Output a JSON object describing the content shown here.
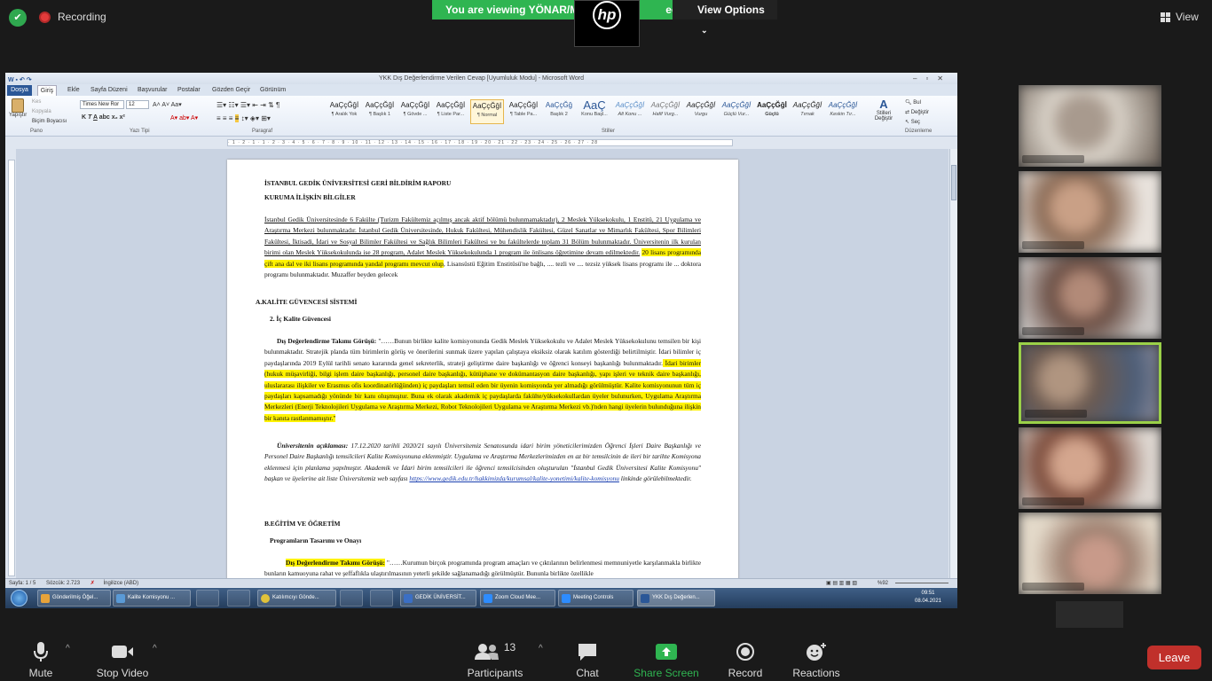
{
  "zoom": {
    "recording_label": "Recording",
    "viewing_banner": "You are viewing YÖNAR/M",
    "viewing_banner_end": "een",
    "view_options_label": "View Options",
    "view_label": "View",
    "presenter_logo": "hp",
    "toolbar": {
      "mute": "Mute",
      "stop_video": "Stop Video",
      "participants": "Participants",
      "participants_count": "13",
      "chat": "Chat",
      "share_screen": "Share Screen",
      "record": "Record",
      "reactions": "Reactions",
      "leave": "Leave"
    },
    "colors": {
      "banner_green": "#2fb551",
      "share_green": "#2fb551",
      "leave_red": "#c0302b",
      "active_speaker": "#9ad048"
    }
  },
  "word": {
    "title": "YKK Dış Değerlendirme Verilen Cevap [Uyumluluk Modu] - Microsoft Word",
    "tabs": [
      "Dosya",
      "Giriş",
      "Ekle",
      "Sayfa Düzeni",
      "Başvurular",
      "Postalar",
      "Gözden Geçir",
      "Görünüm"
    ],
    "clipboard": {
      "paste": "Yapıştır",
      "cut": "Kes",
      "copy": "Kopyala",
      "format_painter": "Biçim Boyacısı",
      "group": "Pano"
    },
    "font": {
      "name": "Times New Ror",
      "size": "12",
      "group": "Yazı Tipi"
    },
    "paragraph_group": "Paragraf",
    "styles_group": "Stiller",
    "editing_group": "Düzenleme",
    "styles": [
      {
        "preview": "AaÇçĞğİ",
        "name": "¶ Aralık Yok"
      },
      {
        "preview": "AaÇçĞğİ",
        "name": "¶ Başlık 1"
      },
      {
        "preview": "AaÇçĞğİ",
        "name": "¶ Gövde ..."
      },
      {
        "preview": "AaÇçĞğİ",
        "name": "¶ Liste Par..."
      },
      {
        "preview": "AaÇçĞğİ",
        "name": "¶ Normal"
      },
      {
        "preview": "AaÇçĞğİ",
        "name": "¶ Table Pa..."
      },
      {
        "preview": "AaÇçĞğ",
        "name": "Başlık 2"
      },
      {
        "preview": "AaÇ",
        "name": "Konu Başl..."
      },
      {
        "preview": "AaÇçĞğİ",
        "name": "Alt Konu ..."
      },
      {
        "preview": "AaÇçĞğİ",
        "name": "Hafif Vurg..."
      },
      {
        "preview": "AaÇçĞğİ",
        "name": "Vurgu"
      },
      {
        "preview": "AaÇçĞğİ",
        "name": "Güçlü Vur..."
      },
      {
        "preview": "AaÇçĞğİ",
        "name": "Güçlü"
      },
      {
        "preview": "AaÇçĞğİ",
        "name": "Tırnak"
      },
      {
        "preview": "AaÇçĞğİ",
        "name": "Keskin Tır..."
      }
    ],
    "change_styles": "Stilleri Değiştir",
    "find": "Bul",
    "replace": "Değiştir",
    "select": "Seç",
    "ruler_text": "· 1 · 2 · 1 · 1 · 2 · 3 · 4 · 5 · 6 · 7 · 8 · 9 · 10 · 11 · 12 · 13 · 14 · 15 · 16 · 17 · 18 · 19 · 20 · 21 · 22 · 23 · 24 · 25 · 26 · 27 · 28",
    "status": {
      "page": "Sayfa: 1 / 5",
      "words": "Sözcük: 2.723",
      "language": "İngilizce (ABD)",
      "zoom": "%92"
    },
    "document": {
      "title1": "İSTANBUL GEDİK ÜNİVERSİTESİ GERİ BİLDİRİM RAPORU",
      "title2": "KURUMA İLİŞKİN BİLGİLER",
      "p1_a": "İstanbul Gedik Üniversitesinde 6 Fakülte (Turizm Fakültemiz açılmış ancak aktif bölümü bulunmamaktadır), 2 Meslek Yüksekokulu, 1 Enstitü, 21 Uygulama ve Araştırma Merkezi bulunmaktadır. İstanbul Gedik Üniversitesinde, Hukuk Fakültesi, Mühendislik Fakültesi, Güzel Sanatlar ve Mimarlık Fakültesi, Spor Bilimleri Fakültesi, İktisadi, İdari ve Sosyal Bilimler Fakültesi ve Sağlık Bilimleri Fakültesi ve bu fakültelerde toplam 31 Bölüm bulunmaktadır. Üniversitenin ilk kurulan birimi olan Meslek Yüksekokulunda ise 28 program, Adalet Meslek Yüksekokulunda 1 program ile önlisans öğretimine devam edilmektedir.",
      "p1_hl": "20 lisans programında çift ana dal ve iki lisans programında yandal programı mevcut olup",
      "p1_b": ", Lisansüstü Eğitim Enstitüsü'ne bağlı, .... tezli ve .... tezsiz yüksek lisans programı ile ... doktora programı bulunmaktadır. Muzaffer beyden gelecek",
      "sec_a": "A.KALİTE GÜVENCESİ SİSTEMİ",
      "sec_a2": "2. İç Kalite Güvencesi",
      "p2_lead": "Dış Değerlendirme Takımı Görüşü:",
      "p2_a": " \"……Bunun birlikte kalite komisyonunda Gedik Meslek Yüksekokulu ve Adalet Meslek Yüksekokulunu temsilen bir kişi bulunmaktadır. Stratejik planda tüm birimlerin görüş ve önerilerini sunmak üzere yapılan çalıştaya eksiksiz olarak katılım gösterdiği belirtilmiştir. İdari bilimler iç paydaşlarında 2019 Eylül tarihli senato kararında genel sekreterlik, strateji geliştirme daire başkanlığı ve öğrenci konseyi başkanlığı bulunmaktadır.",
      "p2_hl": " İdari birimler (hukuk müşavirliği, bilgi işlem daire başkanlığı, personel daire başkanlığı, kütüphane ve dokümantasyon daire başkanlığı, yapı işleri ve teknik daire başkanlığı, uluslararası ilişkiler ve Erasmus ofis koordinatörlüğünden) iç paydaşları temsil eden bir üyenin komisyonda yer almadığı görülmüştür. Kalite komisyonunun tüm iç paydaşları kapsamadığı yönünde bir kanı oluşmuştur. Buna ek olarak akademik iç paydaşlarda fakülte/yüksekokullardan üyeler bulunurken, Uygulama Araştırma Merkezleri (Enerji Teknolojileri Uygulama ve Araştırma Merkezi, Robot Teknolojileri Uygulama ve Araştırma Merkezi vb.)'nden hangi üyelerin bulunduğuna ilişkin bir kanıta rastlanmamıştır.\"",
      "p3_lead": "Üniversitenin açıklaması:",
      "p3_a": " 17.12.2020 tarihli 2020/21 sayılı Üniversitemiz Senatosunda idari birim yöneticilerimizden Öğrenci İşleri Daire Başkanlığı ve Personel Daire Başkanlığı temsilcileri Kalite Komisyonuna eklenmiştir. Uygulama ve Araştırma Merkezlerimizden en az bir temsilcinin de ileri bir tarihte Komisyona eklenmesi için planlama yapılmıştır. Akademik ve İdari birim temsilcileri ile öğrenci temsilcisinden oluşturulan \"İstanbul Gedik Üniversitesi Kalite Komisyonu\" başkan ve üyelerine ait liste Üniversitemiz web sayfası ",
      "p3_link": "https://www.gedik.edu.tr/hakkimizda/kurumsal/kalite-yonetimi/kalite-komisyonu",
      "p3_b": " linkinde görülebilmektedir.",
      "sec_b": "B.EĞİTİM VE ÖĞRETİM",
      "sec_b1": "Programların Tasarımı ve Onayı",
      "p4_lead": "Dış Değerlendirme Takımı Görüşü:",
      "p4_a": " \"……Kurumun birçok programında program amaçları ve çıktılarının belirlenmesi memnuniyetle karşılanmakla birlikte bunların kamuoyuna rahat ve şeffaflıkla ulaştırılmasının yeterli şekilde sağlanamadığı görülmüştür. Bununla birlikte özellikle"
    }
  },
  "taskbar": {
    "items": [
      "Gönderilmiş Öğel...",
      "Kalite Komisyonu ...",
      "Katılımcıyı Gönde...",
      "GEDİK ÜNİVERSİT...",
      "Zoom Cloud Mee...",
      "Meeting Controls",
      "YKK Dış Değerlen..."
    ],
    "time": "09:51",
    "date": "08.04.2021"
  }
}
